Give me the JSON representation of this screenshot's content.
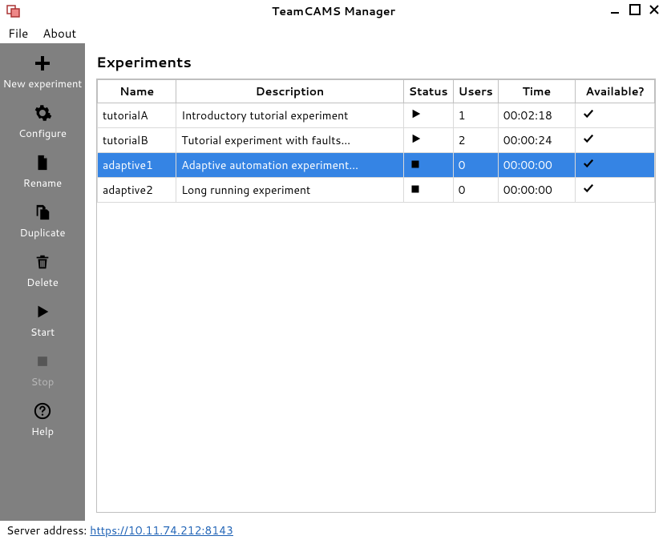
{
  "window": {
    "title": "TeamCAMS Manager"
  },
  "menu": {
    "file": "File",
    "about": "About"
  },
  "sidebar": {
    "items": [
      {
        "label": "New experiment",
        "enabled": true,
        "icon": "plus"
      },
      {
        "label": "Configure",
        "enabled": true,
        "icon": "gear"
      },
      {
        "label": "Rename",
        "enabled": true,
        "icon": "file"
      },
      {
        "label": "Duplicate",
        "enabled": true,
        "icon": "copy"
      },
      {
        "label": "Delete",
        "enabled": true,
        "icon": "trash"
      },
      {
        "label": "Start",
        "enabled": true,
        "icon": "play"
      },
      {
        "label": "Stop",
        "enabled": false,
        "icon": "stop"
      },
      {
        "label": "Help",
        "enabled": true,
        "icon": "help"
      }
    ]
  },
  "main": {
    "heading": "Experiments",
    "columns": [
      "Name",
      "Description",
      "Status",
      "Users",
      "Time",
      "Available?"
    ],
    "rows": [
      {
        "name": "tutorialA",
        "description": "Introductory tutorial experiment",
        "status": "running",
        "users": "1",
        "time": "00:02:18",
        "available": true,
        "selected": false
      },
      {
        "name": "tutorialB",
        "description": "Tutorial experiment with faults…",
        "status": "running",
        "users": "2",
        "time": "00:00:24",
        "available": true,
        "selected": false
      },
      {
        "name": "adaptive1",
        "description": "Adaptive automation experiment…",
        "status": "stopped",
        "users": "0",
        "time": "00:00:00",
        "available": true,
        "selected": true
      },
      {
        "name": "adaptive2",
        "description": "Long running experiment",
        "status": "stopped",
        "users": "0",
        "time": "00:00:00",
        "available": true,
        "selected": false
      }
    ]
  },
  "footer": {
    "label": "Server address:",
    "url": "https://10.11.74.212:8143"
  }
}
